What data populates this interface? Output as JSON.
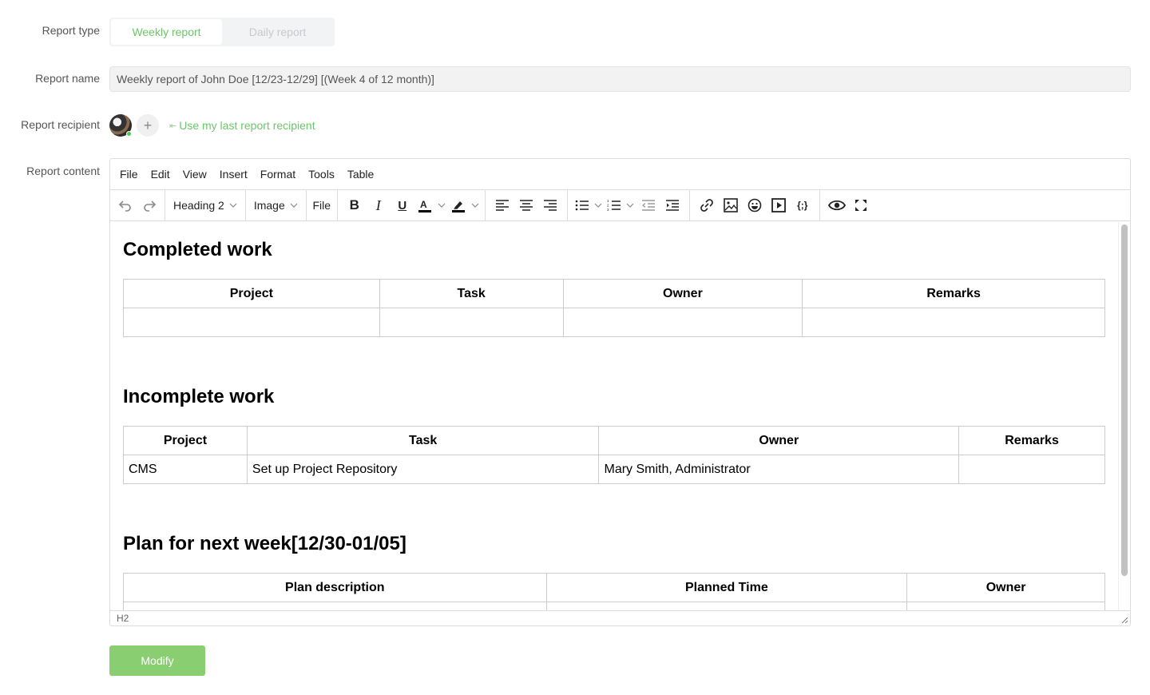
{
  "form": {
    "report_type_label": "Report type",
    "report_type_options": [
      {
        "label": "Weekly report",
        "active": true
      },
      {
        "label": "Daily report",
        "active": false
      }
    ],
    "report_name_label": "Report name",
    "report_name_value": "Weekly report of John Doe [12/23-12/29] [(Week 4 of 12 month)]",
    "report_recipient_label": "Report recipient",
    "add_recipient_icon": "plus-icon",
    "last_recipient_link": "Use my last report recipient",
    "report_content_label": "Report content"
  },
  "editor": {
    "menubar": [
      "File",
      "Edit",
      "View",
      "Insert",
      "Format",
      "Tools",
      "Table"
    ],
    "toolbar": {
      "block_format": "Heading 2",
      "image_dropdown": "Image",
      "file_button": "File"
    },
    "status_path": "H2",
    "sections": [
      {
        "heading": "Completed work",
        "columns": [
          "Project",
          "Task",
          "Owner",
          "Remarks"
        ],
        "rows": [
          [
            "",
            "",
            "",
            ""
          ]
        ]
      },
      {
        "heading": "Incomplete work",
        "columns": [
          "Project",
          "Task",
          "Owner",
          "Remarks"
        ],
        "rows": [
          [
            "CMS",
            "Set up Project Repository",
            "Mary Smith, Administrator",
            ""
          ]
        ]
      },
      {
        "heading": "Plan for next week[12/30-01/05]",
        "columns": [
          "Plan description",
          "Planned Time",
          "Owner"
        ],
        "rows": [
          [
            "",
            "",
            ""
          ]
        ]
      }
    ]
  },
  "actions": {
    "modify_label": "Modify"
  },
  "colors": {
    "accent_green": "#6cc66a",
    "button_green": "#8ace72"
  }
}
